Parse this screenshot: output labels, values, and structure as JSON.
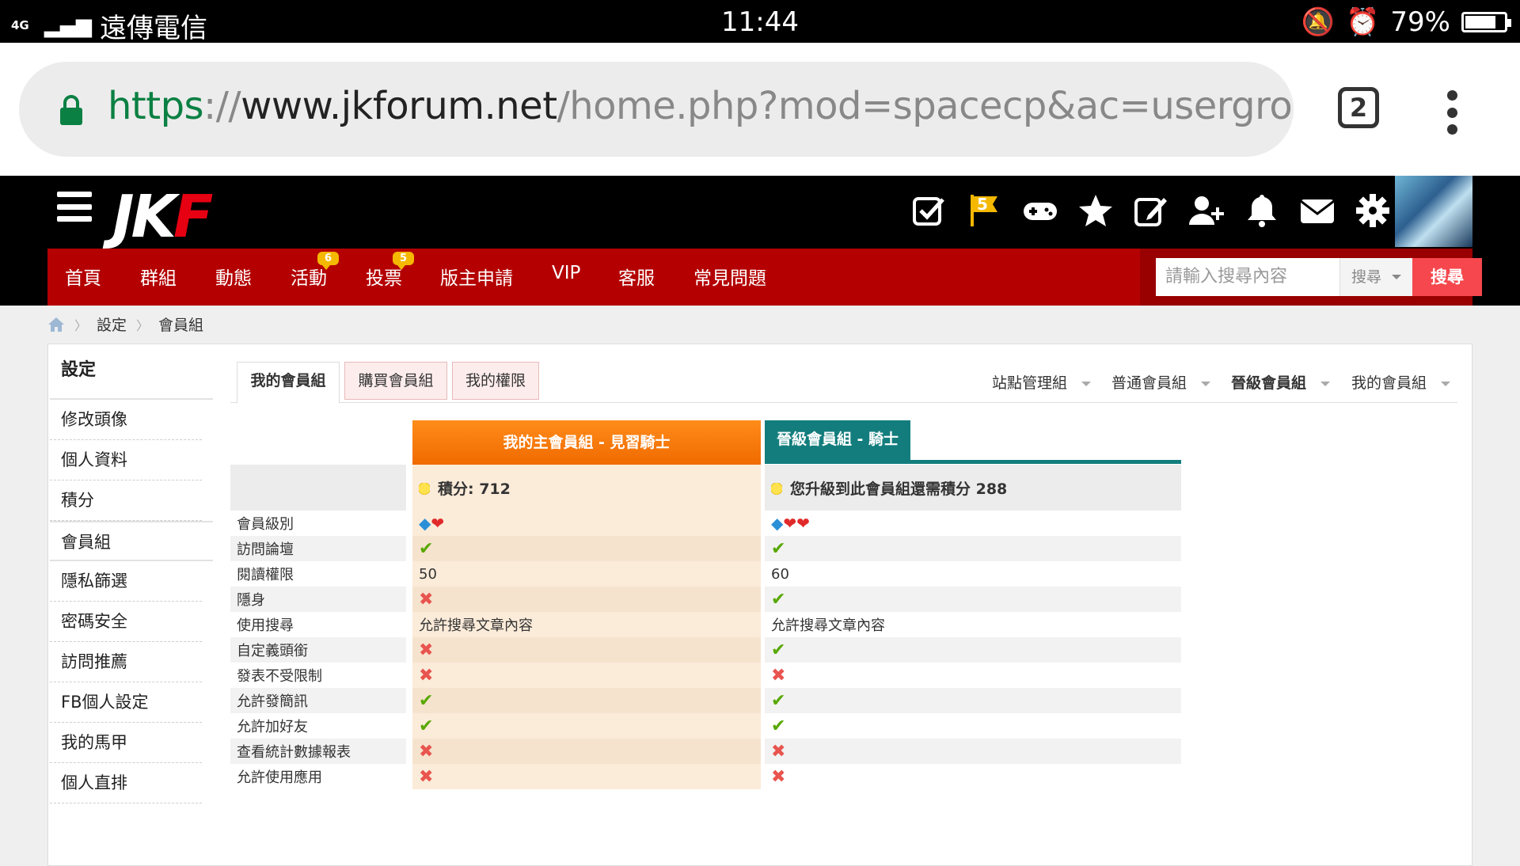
{
  "statusbar": {
    "network": "4G",
    "carrier": "遠傳電信",
    "time": "11:44",
    "battery": "79%",
    "battery_level": 0.79
  },
  "browser": {
    "url_scheme": "https",
    "url_sep": "://",
    "url_host": "www.jkforum.net",
    "url_path": "/home.php?mod=spacecp&ac=usergroup&gi",
    "tab_count": "2"
  },
  "header": {
    "logo_jk": "JK",
    "logo_f": "F",
    "flag_badge": "5",
    "icons": [
      "checkbox-icon",
      "flag-icon",
      "gamepad-icon",
      "star-icon",
      "edit-icon",
      "add-friend-icon",
      "bell-icon",
      "mail-icon",
      "gear-icon"
    ]
  },
  "nav": {
    "items": [
      {
        "label": "首頁",
        "badge": ""
      },
      {
        "label": "群組",
        "badge": ""
      },
      {
        "label": "動態",
        "badge": ""
      },
      {
        "label": "活動",
        "badge": "6"
      },
      {
        "label": "投票",
        "badge": "5"
      },
      {
        "label": "版主申請",
        "badge": ""
      },
      {
        "label": "VIP",
        "badge": ""
      },
      {
        "label": "客服",
        "badge": ""
      },
      {
        "label": "常見問題",
        "badge": ""
      }
    ],
    "search_placeholder": "請輸入搜尋內容",
    "search_type": "搜尋",
    "search_button": "搜尋"
  },
  "breadcrumb": {
    "items": [
      "設定",
      "會員組"
    ]
  },
  "sidebar": {
    "title": "設定",
    "items": [
      "修改頭像",
      "個人資料",
      "積分",
      "會員組",
      "隱私篩選",
      "密碼安全",
      "訪問推薦",
      "FB個人設定",
      "我的馬甲",
      "個人直排"
    ],
    "active_index": 3
  },
  "tabs": [
    "我的會員組",
    "購買會員組",
    "我的權限"
  ],
  "group_filters": [
    "站點管理組",
    "普通會員組",
    "晉級會員組",
    "我的會員組"
  ],
  "columns": {
    "main_title": "我的主會員組 - 見習騎士",
    "upgrade_title": "晉級會員組 - 騎士",
    "main_points": "積分: 712",
    "upgrade_points": "您升級到此會員組還需積分 288"
  },
  "rows": [
    {
      "label": "會員級別",
      "main": "level",
      "main_hearts": 1,
      "up": "level",
      "up_hearts": 2
    },
    {
      "label": "訪問論壇",
      "main": "yes",
      "up": "yes"
    },
    {
      "label": "閱讀權限",
      "main": "50",
      "up": "60"
    },
    {
      "label": "隱身",
      "main": "no",
      "up": "yes"
    },
    {
      "label": "使用搜尋",
      "main": "允許搜尋文章內容",
      "up": "允許搜尋文章內容"
    },
    {
      "label": "自定義頭銜",
      "main": "no",
      "up": "yes"
    },
    {
      "label": "發表不受限制",
      "main": "no",
      "up": "no"
    },
    {
      "label": "允許發簡訊",
      "main": "yes",
      "up": "yes"
    },
    {
      "label": "允許加好友",
      "main": "yes",
      "up": "yes"
    },
    {
      "label": "查看統計數據報表",
      "main": "no",
      "up": "no"
    },
    {
      "label": "允許使用應用",
      "main": "no",
      "up": "no"
    }
  ],
  "colors": {
    "brand_red": "#b40000",
    "orange": "#f07a00",
    "teal": "#137d7d",
    "tick": "#58a800",
    "cross": "#e8544e"
  }
}
